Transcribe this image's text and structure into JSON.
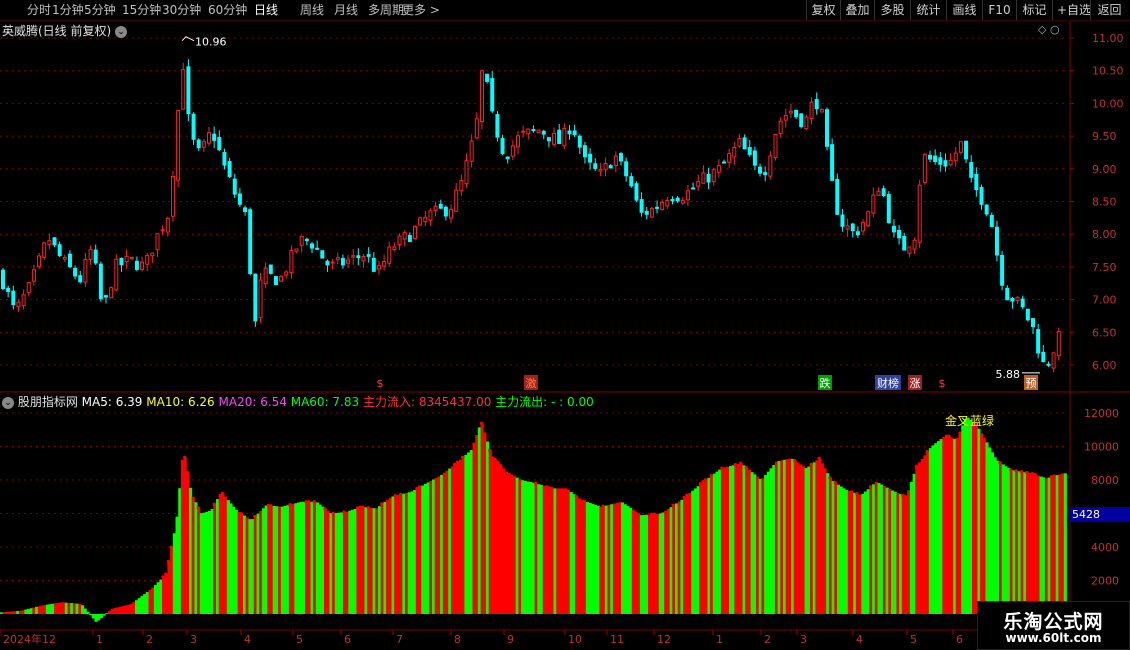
{
  "toolbar": {
    "periods": [
      "分时",
      "1分钟",
      "5分钟",
      "15分钟",
      "30分钟",
      "60分钟",
      "日线",
      "周线",
      "月线",
      "多周期",
      "更多 >"
    ],
    "active": "日线",
    "buttons": [
      "复权",
      "叠加",
      "多股",
      "统计",
      "画线",
      "F10",
      "标记",
      "+自选",
      "返回"
    ]
  },
  "main_title": "英威腾(日线 前复权)",
  "sub_title": "股朋指标网",
  "indicators": [
    {
      "label": "MA5: 6.39",
      "color": "#ffffff"
    },
    {
      "label": "MA10: 6.26",
      "color": "#ffff00"
    },
    {
      "label": "MA20: 6.54",
      "color": "#ff40ff"
    },
    {
      "label": "MA60: 7.83",
      "color": "#00ff00"
    },
    {
      "label": "主力流入: 8345437.00",
      "color": "#ff3030"
    },
    {
      "label": "主力流出: - : 0.00",
      "color": "#00ff00"
    }
  ],
  "current_value": "5428",
  "colors": {
    "up": "#ff2020",
    "down": "#00ffff",
    "bar_up": "#ff0000",
    "bar_down": "#00ff00",
    "grid": "#800000"
  },
  "chart_data": [
    {
      "type": "candlestick",
      "title": "英威腾(日线 前复权)",
      "ylim": [
        5.75,
        11.2
      ],
      "yticks": [
        "11.00",
        "10.50",
        "10.00",
        "9.50",
        "9.00",
        "8.50",
        "8.00",
        "7.50",
        "7.00",
        "6.50",
        "6.00"
      ],
      "annotations": [
        "10.96",
        "5.88"
      ],
      "markers": [
        "$",
        "激",
        "跌",
        "财榜",
        "涨",
        "$",
        "预"
      ],
      "close_trend": [
        [
          0,
          7.4
        ],
        [
          15,
          6.8
        ],
        [
          30,
          7.2
        ],
        [
          48,
          7.95
        ],
        [
          62,
          7.6
        ],
        [
          80,
          7.3
        ],
        [
          92,
          7.8
        ],
        [
          103,
          6.8
        ],
        [
          115,
          7.5
        ],
        [
          130,
          7.6
        ],
        [
          145,
          7.5
        ],
        [
          155,
          7.9
        ],
        [
          168,
          8.3
        ],
        [
          176,
          9.4
        ],
        [
          182,
          10.8
        ],
        [
          190,
          9.5
        ],
        [
          200,
          9.2
        ],
        [
          212,
          9.6
        ],
        [
          225,
          9.0
        ],
        [
          238,
          8.5
        ],
        [
          245,
          8.3
        ],
        [
          250,
          7.5
        ],
        [
          255,
          6.6
        ],
        [
          262,
          7.4
        ],
        [
          280,
          7.3
        ],
        [
          300,
          7.9
        ],
        [
          310,
          7.9
        ],
        [
          330,
          7.5
        ],
        [
          350,
          7.6
        ],
        [
          365,
          7.7
        ],
        [
          378,
          7.4
        ],
        [
          392,
          7.8
        ],
        [
          410,
          8.0
        ],
        [
          430,
          8.3
        ],
        [
          450,
          8.4
        ],
        [
          462,
          8.8
        ],
        [
          476,
          9.6
        ],
        [
          483,
          10.6
        ],
        [
          492,
          9.8
        ],
        [
          505,
          9.2
        ],
        [
          520,
          9.5
        ],
        [
          540,
          9.6
        ],
        [
          560,
          9.4
        ],
        [
          572,
          9.7
        ],
        [
          585,
          9.1
        ],
        [
          600,
          8.9
        ],
        [
          615,
          9.2
        ],
        [
          630,
          8.8
        ],
        [
          640,
          8.3
        ],
        [
          655,
          8.4
        ],
        [
          668,
          8.6
        ],
        [
          685,
          8.6
        ],
        [
          700,
          8.8
        ],
        [
          720,
          9.0
        ],
        [
          740,
          9.4
        ],
        [
          755,
          9.0
        ],
        [
          765,
          9.0
        ],
        [
          778,
          9.7
        ],
        [
          790,
          9.9
        ],
        [
          805,
          9.7
        ],
        [
          815,
          10.1
        ],
        [
          822,
          9.8
        ],
        [
          830,
          8.9
        ],
        [
          840,
          8.2
        ],
        [
          855,
          8.0
        ],
        [
          868,
          8.3
        ],
        [
          880,
          8.8
        ],
        [
          895,
          7.9
        ],
        [
          905,
          7.8
        ],
        [
          915,
          8.0
        ],
        [
          922,
          9.2
        ],
        [
          935,
          9.1
        ],
        [
          950,
          9.1
        ],
        [
          962,
          9.4
        ],
        [
          970,
          8.8
        ],
        [
          980,
          8.6
        ],
        [
          990,
          8.3
        ],
        [
          997,
          7.7
        ],
        [
          1005,
          7.1
        ],
        [
          1015,
          7.0
        ],
        [
          1025,
          6.8
        ],
        [
          1035,
          6.5
        ],
        [
          1042,
          6.0
        ],
        [
          1048,
          6.05
        ],
        [
          1055,
          6.3
        ],
        [
          1062,
          6.5
        ]
      ],
      "xlabels": [
        "2024年12",
        "1",
        "2",
        "3",
        "4",
        "5",
        "6",
        "7",
        "8",
        "9",
        "10",
        "11",
        "12",
        "1",
        "2",
        "3",
        "4",
        "5",
        "6"
      ]
    },
    {
      "type": "bar",
      "title": "股朋指标网",
      "ylim": [
        0,
        13000
      ],
      "yticks": [
        "12000",
        "10000",
        "8000",
        "6000",
        "4000",
        "2000"
      ],
      "annotations": [
        "金叉",
        "蓝绿"
      ],
      "level_trend": [
        [
          0,
          100
        ],
        [
          20,
          200
        ],
        [
          40,
          500
        ],
        [
          60,
          700
        ],
        [
          80,
          600
        ],
        [
          95,
          -500
        ],
        [
          110,
          300
        ],
        [
          130,
          600
        ],
        [
          150,
          1500
        ],
        [
          165,
          2400
        ],
        [
          175,
          5500
        ],
        [
          182,
          9900
        ],
        [
          190,
          7200
        ],
        [
          200,
          6000
        ],
        [
          210,
          6200
        ],
        [
          220,
          7300
        ],
        [
          235,
          6200
        ],
        [
          250,
          5600
        ],
        [
          265,
          6500
        ],
        [
          280,
          6400
        ],
        [
          300,
          6700
        ],
        [
          315,
          6700
        ],
        [
          330,
          6000
        ],
        [
          345,
          6100
        ],
        [
          360,
          6400
        ],
        [
          375,
          6300
        ],
        [
          390,
          7000
        ],
        [
          410,
          7300
        ],
        [
          425,
          7800
        ],
        [
          440,
          8300
        ],
        [
          455,
          9000
        ],
        [
          470,
          9800
        ],
        [
          480,
          11500
        ],
        [
          490,
          9500
        ],
        [
          505,
          8500
        ],
        [
          520,
          8000
        ],
        [
          535,
          7800
        ],
        [
          550,
          7500
        ],
        [
          565,
          7500
        ],
        [
          580,
          6800
        ],
        [
          600,
          6400
        ],
        [
          620,
          6700
        ],
        [
          640,
          5900
        ],
        [
          660,
          6000
        ],
        [
          680,
          6800
        ],
        [
          700,
          7800
        ],
        [
          720,
          8700
        ],
        [
          740,
          9000
        ],
        [
          760,
          8000
        ],
        [
          775,
          9100
        ],
        [
          790,
          9300
        ],
        [
          805,
          8700
        ],
        [
          818,
          9300
        ],
        [
          830,
          8000
        ],
        [
          845,
          7400
        ],
        [
          860,
          7100
        ],
        [
          875,
          7900
        ],
        [
          890,
          7400
        ],
        [
          905,
          7000
        ],
        [
          915,
          8800
        ],
        [
          930,
          10000
        ],
        [
          945,
          10700
        ],
        [
          955,
          10400
        ],
        [
          965,
          11800
        ],
        [
          975,
          11300
        ],
        [
          985,
          10300
        ],
        [
          995,
          9200
        ],
        [
          1010,
          8600
        ],
        [
          1030,
          8400
        ],
        [
          1045,
          8100
        ],
        [
          1062,
          8400
        ]
      ]
    }
  ]
}
